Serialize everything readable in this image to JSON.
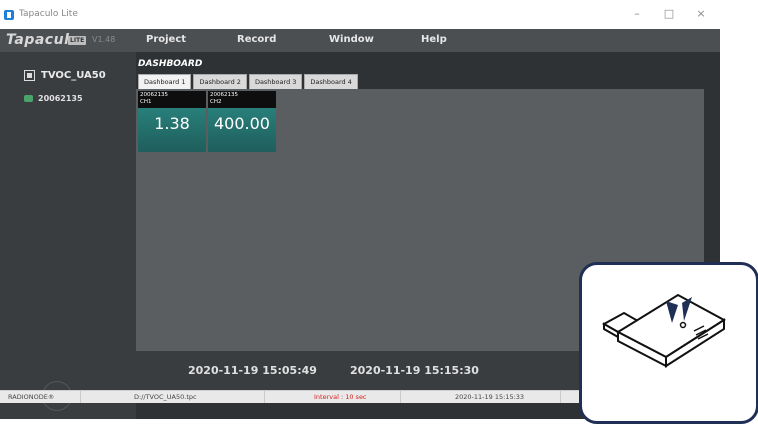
{
  "window": {
    "title": "Tapaculo Lite",
    "controls": {
      "minimize": "–",
      "maximize": "□",
      "close": "×"
    }
  },
  "app": {
    "brand": "Tapaculo",
    "badge": "LITE",
    "version": "V1.48",
    "menu": [
      "Project",
      "Record",
      "Window",
      "Help"
    ]
  },
  "sidebar": {
    "device": "TVOC_UA50",
    "sensor": "20062135",
    "rec_label": "REC"
  },
  "dashboard": {
    "title": "DASHBOARD",
    "tabs": [
      "Dashboard 1",
      "Dashboard 2",
      "Dashboard 3",
      "Dashboard 4"
    ],
    "tiles": [
      {
        "id": "20062135",
        "channel": "CH1",
        "value": "1.38"
      },
      {
        "id": "20062135",
        "channel": "CH2",
        "value": "400.00"
      }
    ]
  },
  "times": {
    "start": "2020-11-19 15:05:49",
    "end": "2020-11-19 15:15:30"
  },
  "status": {
    "brand": "RADIONODE®",
    "file": "D://TVOC_UA50.tpc",
    "interval": "Interval : 10 sec",
    "timestamp": "2020-11-19 15:15:33"
  },
  "icons": {
    "device": "device-icon",
    "sensor": "sensor-icon",
    "inset": "usb-dongle-icon"
  },
  "colors": {
    "interval_text": "#d51f1f",
    "tile_top": "#2c8c86",
    "inset_border": "#1f2f55"
  }
}
